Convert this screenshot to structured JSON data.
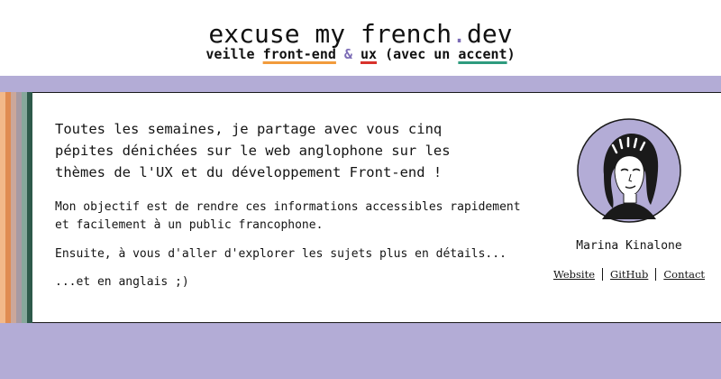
{
  "header": {
    "title_part1": "excuse my french",
    "title_dot": ".",
    "title_part2": "dev",
    "tagline_prefix": "veille ",
    "tagline_frontend": "front-end",
    "tagline_amp": " & ",
    "tagline_ux": "ux",
    "tagline_middle": " (avec un ",
    "tagline_accent": "accent",
    "tagline_suffix": ")"
  },
  "stripes": [
    "#f2b98a",
    "#e08c52",
    "#cba79a",
    "#a79aa3",
    "#86a89b",
    "#2e5a4a"
  ],
  "main": {
    "intro": "Toutes les semaines, je partage avec vous cinq pépites dénichées sur le web anglophone sur les thèmes de l'UX et du développement Front-end !",
    "paragraph1": "Mon objectif est de rendre ces informations accessibles rapidement et facilement à un public francophone.",
    "paragraph2": "Ensuite, à vous d'aller d'explorer les sujets plus en détails...",
    "paragraph3": "...et en anglais ;)"
  },
  "author": {
    "name": "Marina Kinalone",
    "links": {
      "website": "Website",
      "github": "GitHub",
      "contact": "Contact"
    }
  },
  "colors": {
    "background": "#b3acd6",
    "accent_purple": "#7b6bb5",
    "underline_orange": "#f29b3c",
    "underline_red": "#d8322b",
    "underline_green": "#2e9b7e"
  }
}
